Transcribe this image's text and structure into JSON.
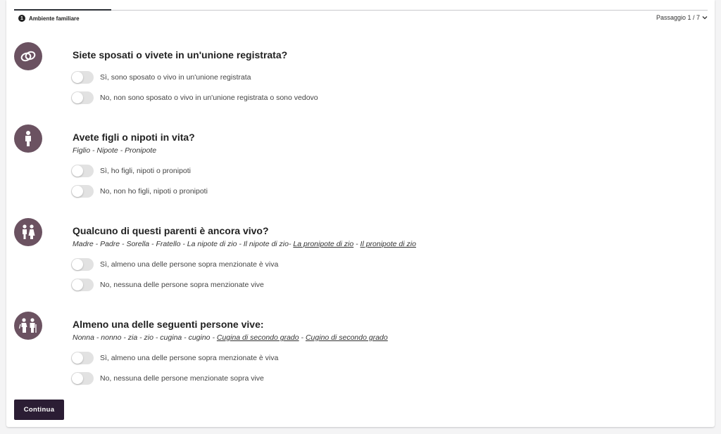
{
  "stepper": {
    "step_number": "1",
    "step_title": "Ambiente familiare",
    "counter": "Passaggio 1 / 7",
    "progress_fraction": 0.14
  },
  "sections": [
    {
      "icon": "wedding-rings-icon",
      "title": "Siete sposati o vivete in un'unione registrata?",
      "options": [
        "Sì, sono sposato o vivo in un'unione registrata",
        "No, non sono sposato o vivo in un'unione registrata o sono vedovo"
      ]
    },
    {
      "icon": "child-icon",
      "title": "Avete figli o nipoti in vita?",
      "subtitle_plain": "Figlio - Nipote - Pronipote",
      "options": [
        "Sì, ho figli, nipoti o pronipoti",
        "No, non ho figli, nipoti o pronipoti"
      ]
    },
    {
      "icon": "parents-icon",
      "title": "Qualcuno di questi parenti è ancora vivo?",
      "subtitle_plain": "Madre - Padre - Sorella - Fratello - La nipote di zio - Il nipote di zio-",
      "subtitle_link1": "La pronipote di zio",
      "subtitle_sep": " - ",
      "subtitle_link2": "Il pronipote di zio",
      "options": [
        "Sì, almeno una delle persone sopra menzionate è viva",
        "No, nessuna delle persone sopra menzionate vive"
      ]
    },
    {
      "icon": "grandparents-icon",
      "title": "Almeno una delle seguenti persone vive:",
      "subtitle_plain": "Nonna - nonno - zia - zio - cugina - cugino - ",
      "subtitle_link1": "Cugina di secondo grado",
      "subtitle_sep": " - ",
      "subtitle_link2": "Cugino di secondo grado",
      "options": [
        "Sì, almeno una delle persone sopra menzionate è viva",
        "No, nessuna delle persone menzionate sopra vive"
      ]
    }
  ],
  "actions": {
    "continue_label": "Continua"
  },
  "colors": {
    "icon_bg": "#6b5261",
    "button_bg": "#2b1d34",
    "toggle_off": "#e2e2e2"
  }
}
